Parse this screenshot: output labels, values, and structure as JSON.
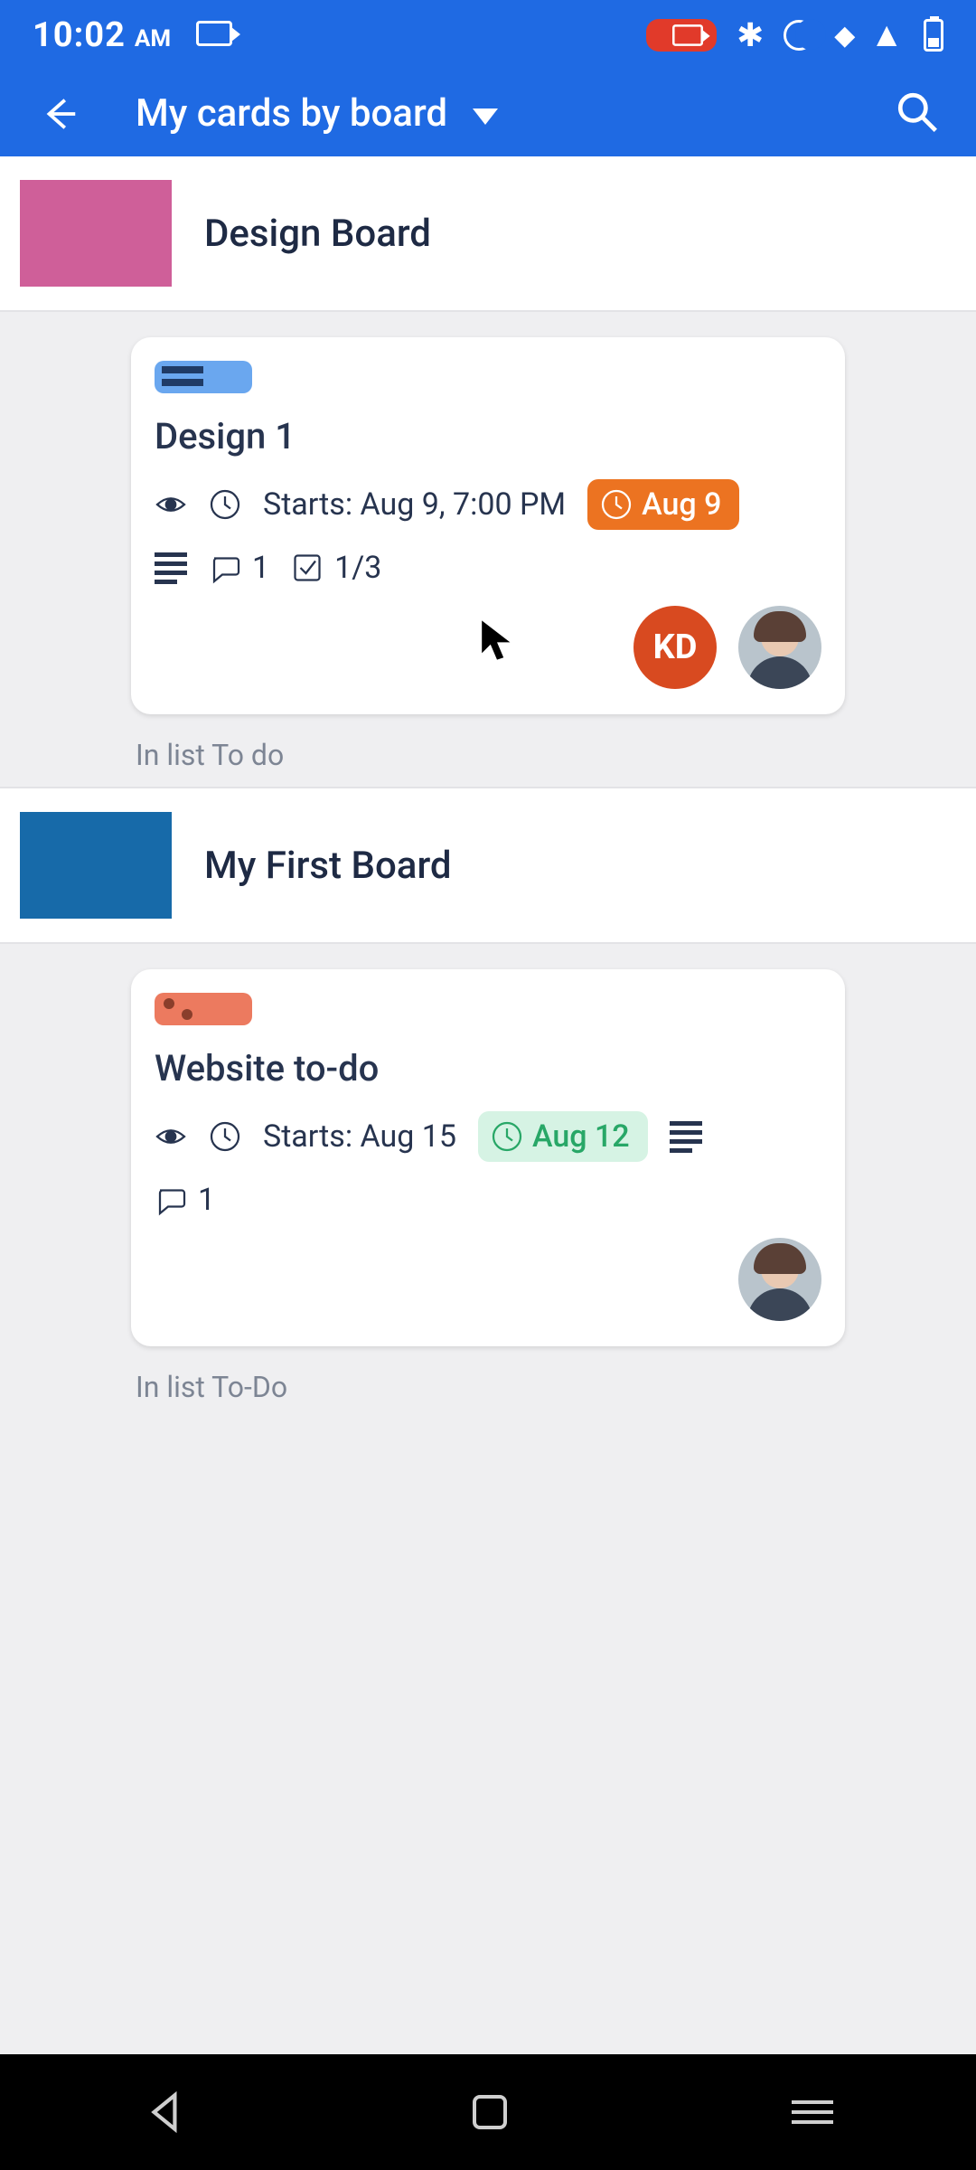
{
  "statusbar": {
    "time": "10:02",
    "ampm": "AM"
  },
  "appbar": {
    "title": "My cards by board"
  },
  "boards": [
    {
      "name": "Design Board",
      "swatch": "pink",
      "card": {
        "label_style": "blue",
        "title": "Design 1",
        "start_text": "Starts: Aug 9, 7:00 PM",
        "due_text": "Aug 9",
        "due_style": "orange",
        "comments": "1",
        "checklist": "1/3",
        "has_description": true,
        "has_watch": true,
        "members": [
          {
            "type": "initials",
            "text": "KD"
          },
          {
            "type": "person"
          }
        ]
      },
      "list_caption": "In list To do"
    },
    {
      "name": "My First Board",
      "swatch": "blue",
      "card": {
        "label_style": "red",
        "title": "Website to-do",
        "start_text": "Starts: Aug 15",
        "due_text": "Aug 12",
        "due_style": "green",
        "comments": "1",
        "checklist": "",
        "has_description": true,
        "has_watch": true,
        "members": [
          {
            "type": "person"
          }
        ]
      },
      "list_caption": "In list To-Do"
    }
  ]
}
